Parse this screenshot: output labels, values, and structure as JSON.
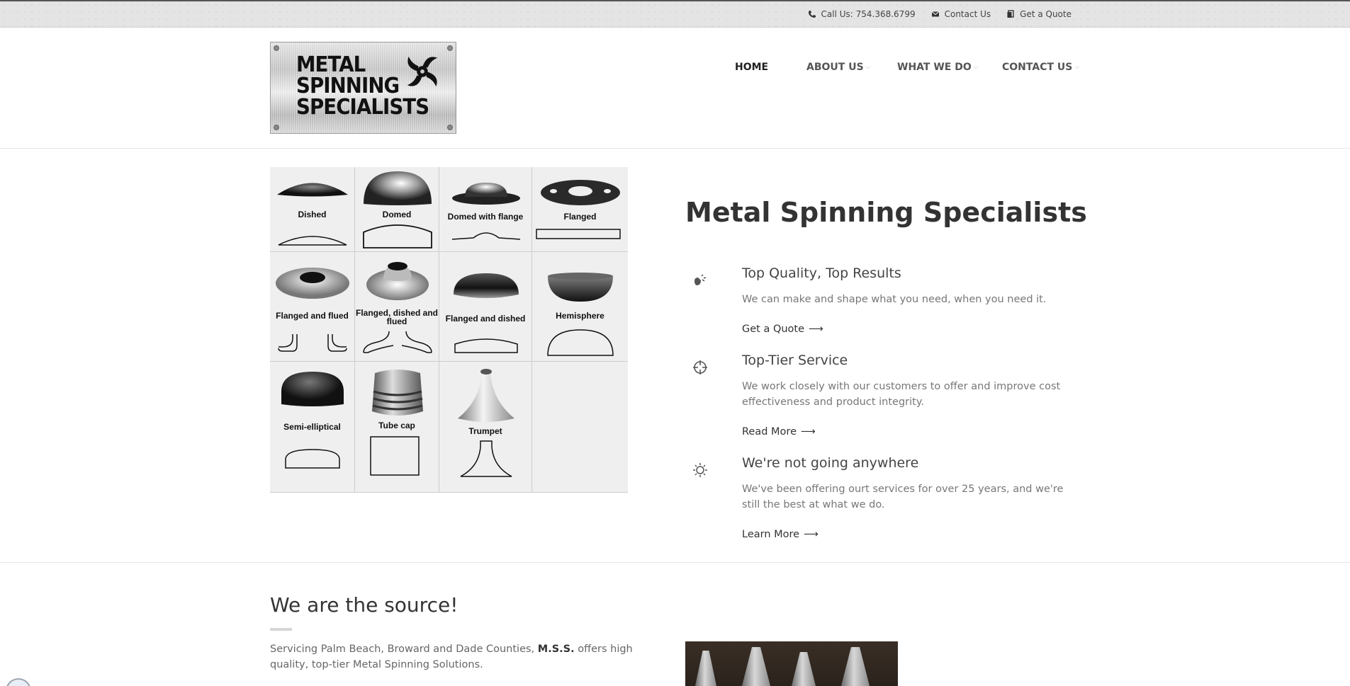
{
  "topbar": {
    "phone": "Call Us: 754.368.6799",
    "contact": "Contact Us",
    "quote": "Get a Quote"
  },
  "logo": {
    "line1": "METAL",
    "line2": "SPINNING",
    "line3": "SPECIALISTS"
  },
  "nav": {
    "items": [
      {
        "label": "HOME",
        "active": true
      },
      {
        "label": "ABOUT US"
      },
      {
        "label": "WHAT WE DO"
      },
      {
        "label": "CONTACT US"
      }
    ]
  },
  "products": [
    {
      "label": "Dished"
    },
    {
      "label": "Domed"
    },
    {
      "label": "Domed with flange"
    },
    {
      "label": "Flanged"
    },
    {
      "label": "Flanged and flued"
    },
    {
      "label": "Flanged, dished and flued"
    },
    {
      "label": "Flanged and dished"
    },
    {
      "label": "Hemisphere"
    },
    {
      "label": "Semi-elliptical"
    },
    {
      "label": "Tube cap"
    },
    {
      "label": "Trumpet"
    }
  ],
  "hero": {
    "title": "Metal Spinning Specialists"
  },
  "features": [
    {
      "icon": "flashlight-icon",
      "title": "Top Quality, Top Results",
      "text": "We can make and shape what you need, when you need it.",
      "link": "Get a Quote"
    },
    {
      "icon": "crosshair-icon",
      "title": "Top-Tier Service",
      "text": "We work closely with our customers to offer and improve cost effectiveness and product integrity.",
      "link": "Read More"
    },
    {
      "icon": "sun-icon",
      "title": "We're not going anywhere",
      "text": "We've been offering ourt services for over 25 years, and we're still the best at what we do.",
      "link": "Learn More"
    }
  ],
  "source": {
    "title": "We are the source!",
    "text_before": "Servicing Palm Beach, Broward and Dade Counties, ",
    "text_bold": "M.S.S.",
    "text_after": " offers high quality, top-tier Metal Spinning Solutions."
  },
  "arrow": "⟶"
}
